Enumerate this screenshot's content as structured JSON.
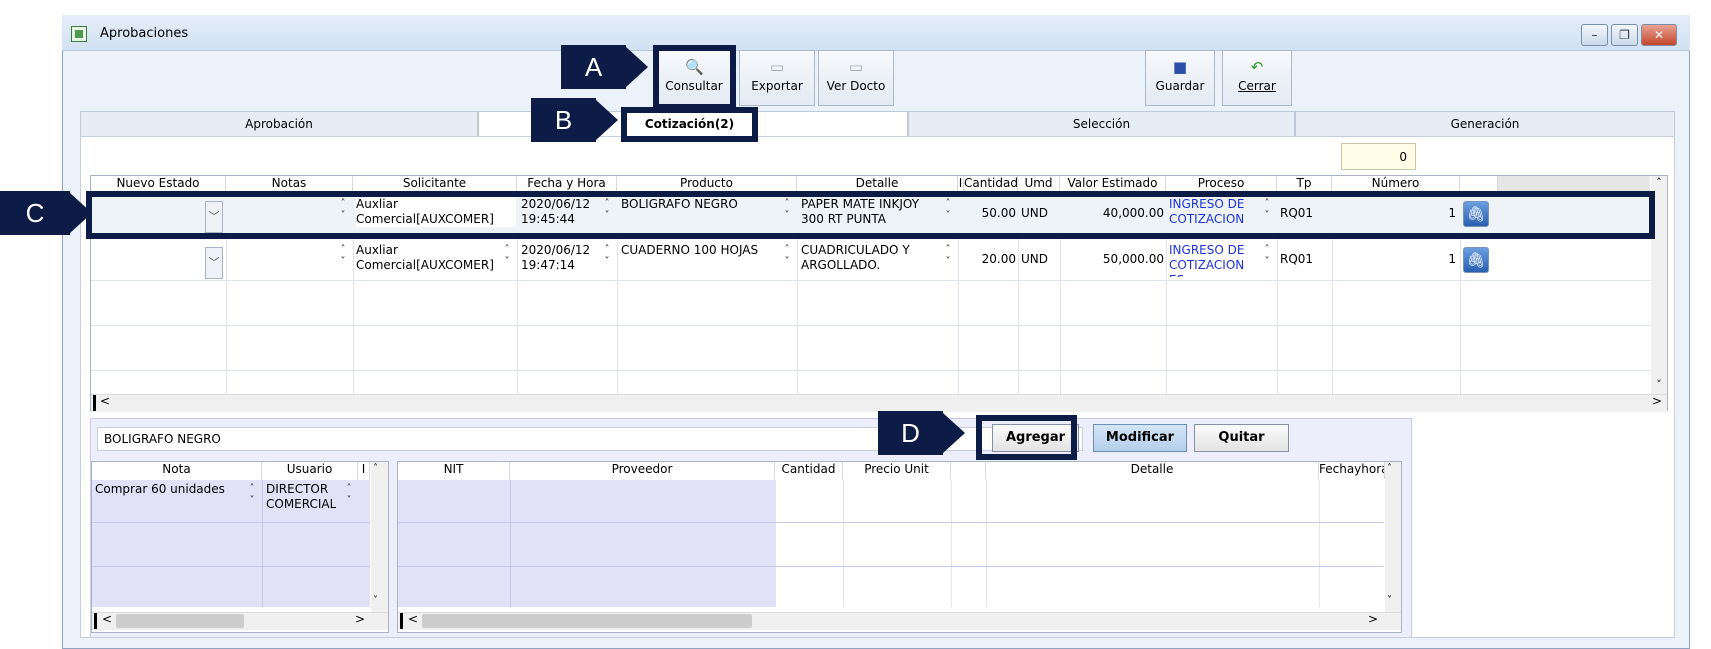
{
  "window": {
    "title": "Aprobaciones",
    "controls": [
      "–",
      "❐",
      "✕"
    ]
  },
  "toolbar": {
    "consultar": "Consultar",
    "exportar": "Exportar",
    "ver_docto": "Ver Docto",
    "guardar": "Guardar",
    "cerrar": "Cerrar"
  },
  "tabs": [
    "Aprobación",
    "Cotización(2)",
    "Selección",
    "Generación"
  ],
  "counter": "0",
  "callouts": {
    "a": "A",
    "b": "B",
    "c": "C",
    "d": "D"
  },
  "grid": {
    "headers": [
      "Nuevo Estado",
      "Notas",
      "Solicitante",
      "Fecha y Hora",
      "Producto",
      "Detalle",
      "I",
      "Cantidad",
      "Umd",
      "Valor Estimado",
      "Proceso",
      "Tp",
      "Número"
    ],
    "rows": [
      {
        "solicitante_1": "Auxliar",
        "solicitante_2": "Comercial[AUXCOMER]",
        "fecha_1": "2020/06/12",
        "fecha_2": "19:45:44",
        "producto": "BOLIGRAFO NEGRO",
        "detalle_1": "PAPER MATE INKJOY",
        "detalle_2": "300 RT PUNTA",
        "cantidad": "50.00",
        "umd": "UND",
        "valor": "40,000.00",
        "proceso_1": "INGRESO DE",
        "proceso_2": "COTIZACION",
        "tp": "RQ01",
        "numero": "1"
      },
      {
        "solicitante_1": "Auxliar",
        "solicitante_2": "Comercial[AUXCOMER]",
        "fecha_1": "2020/06/12",
        "fecha_2": "19:47:14",
        "producto": "CUADERNO 100 HOJAS",
        "detalle_1": "CUADRICULADO Y",
        "detalle_2": "ARGOLLADO.",
        "cantidad": "20.00",
        "umd": "UND",
        "valor": "50,000.00",
        "proceso_1": "INGRESO DE",
        "proceso_2": "COTIZACION",
        "proceso_3": "ES",
        "tp": "RQ01",
        "numero": "1"
      }
    ]
  },
  "detail": {
    "description": "BOLIGRAFO NEGRO",
    "buttons": {
      "agregar": "Agregar",
      "modificar": "Modificar",
      "quitar": "Quitar"
    },
    "notes_headers": [
      "Nota",
      "Usuario",
      "I"
    ],
    "note_row": {
      "nota": "Comprar 60 unidades",
      "usuario_1": "DIRECTOR",
      "usuario_2": "COMERCIAL"
    },
    "prov_headers": [
      "NIT",
      "Proveedor",
      "Cantidad",
      "Precio Unit",
      "",
      "Detalle",
      "Fechayhora"
    ]
  }
}
